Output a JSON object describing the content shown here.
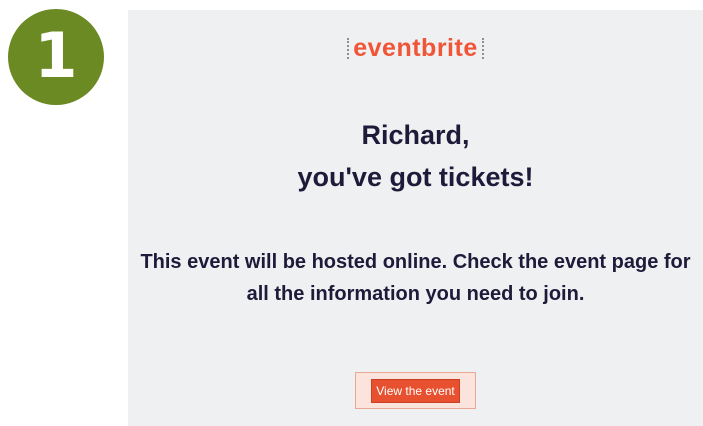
{
  "step": {
    "number": "1",
    "color": "#6b8a23"
  },
  "email": {
    "logo_text": "eventbrite",
    "brand_color": "#f05537",
    "greeting_line1": "Richard,",
    "greeting_line2": "you've got tickets!",
    "body": "This event will be hosted online. Check the event page for all the information you need to join.",
    "button_label": "View the event"
  }
}
